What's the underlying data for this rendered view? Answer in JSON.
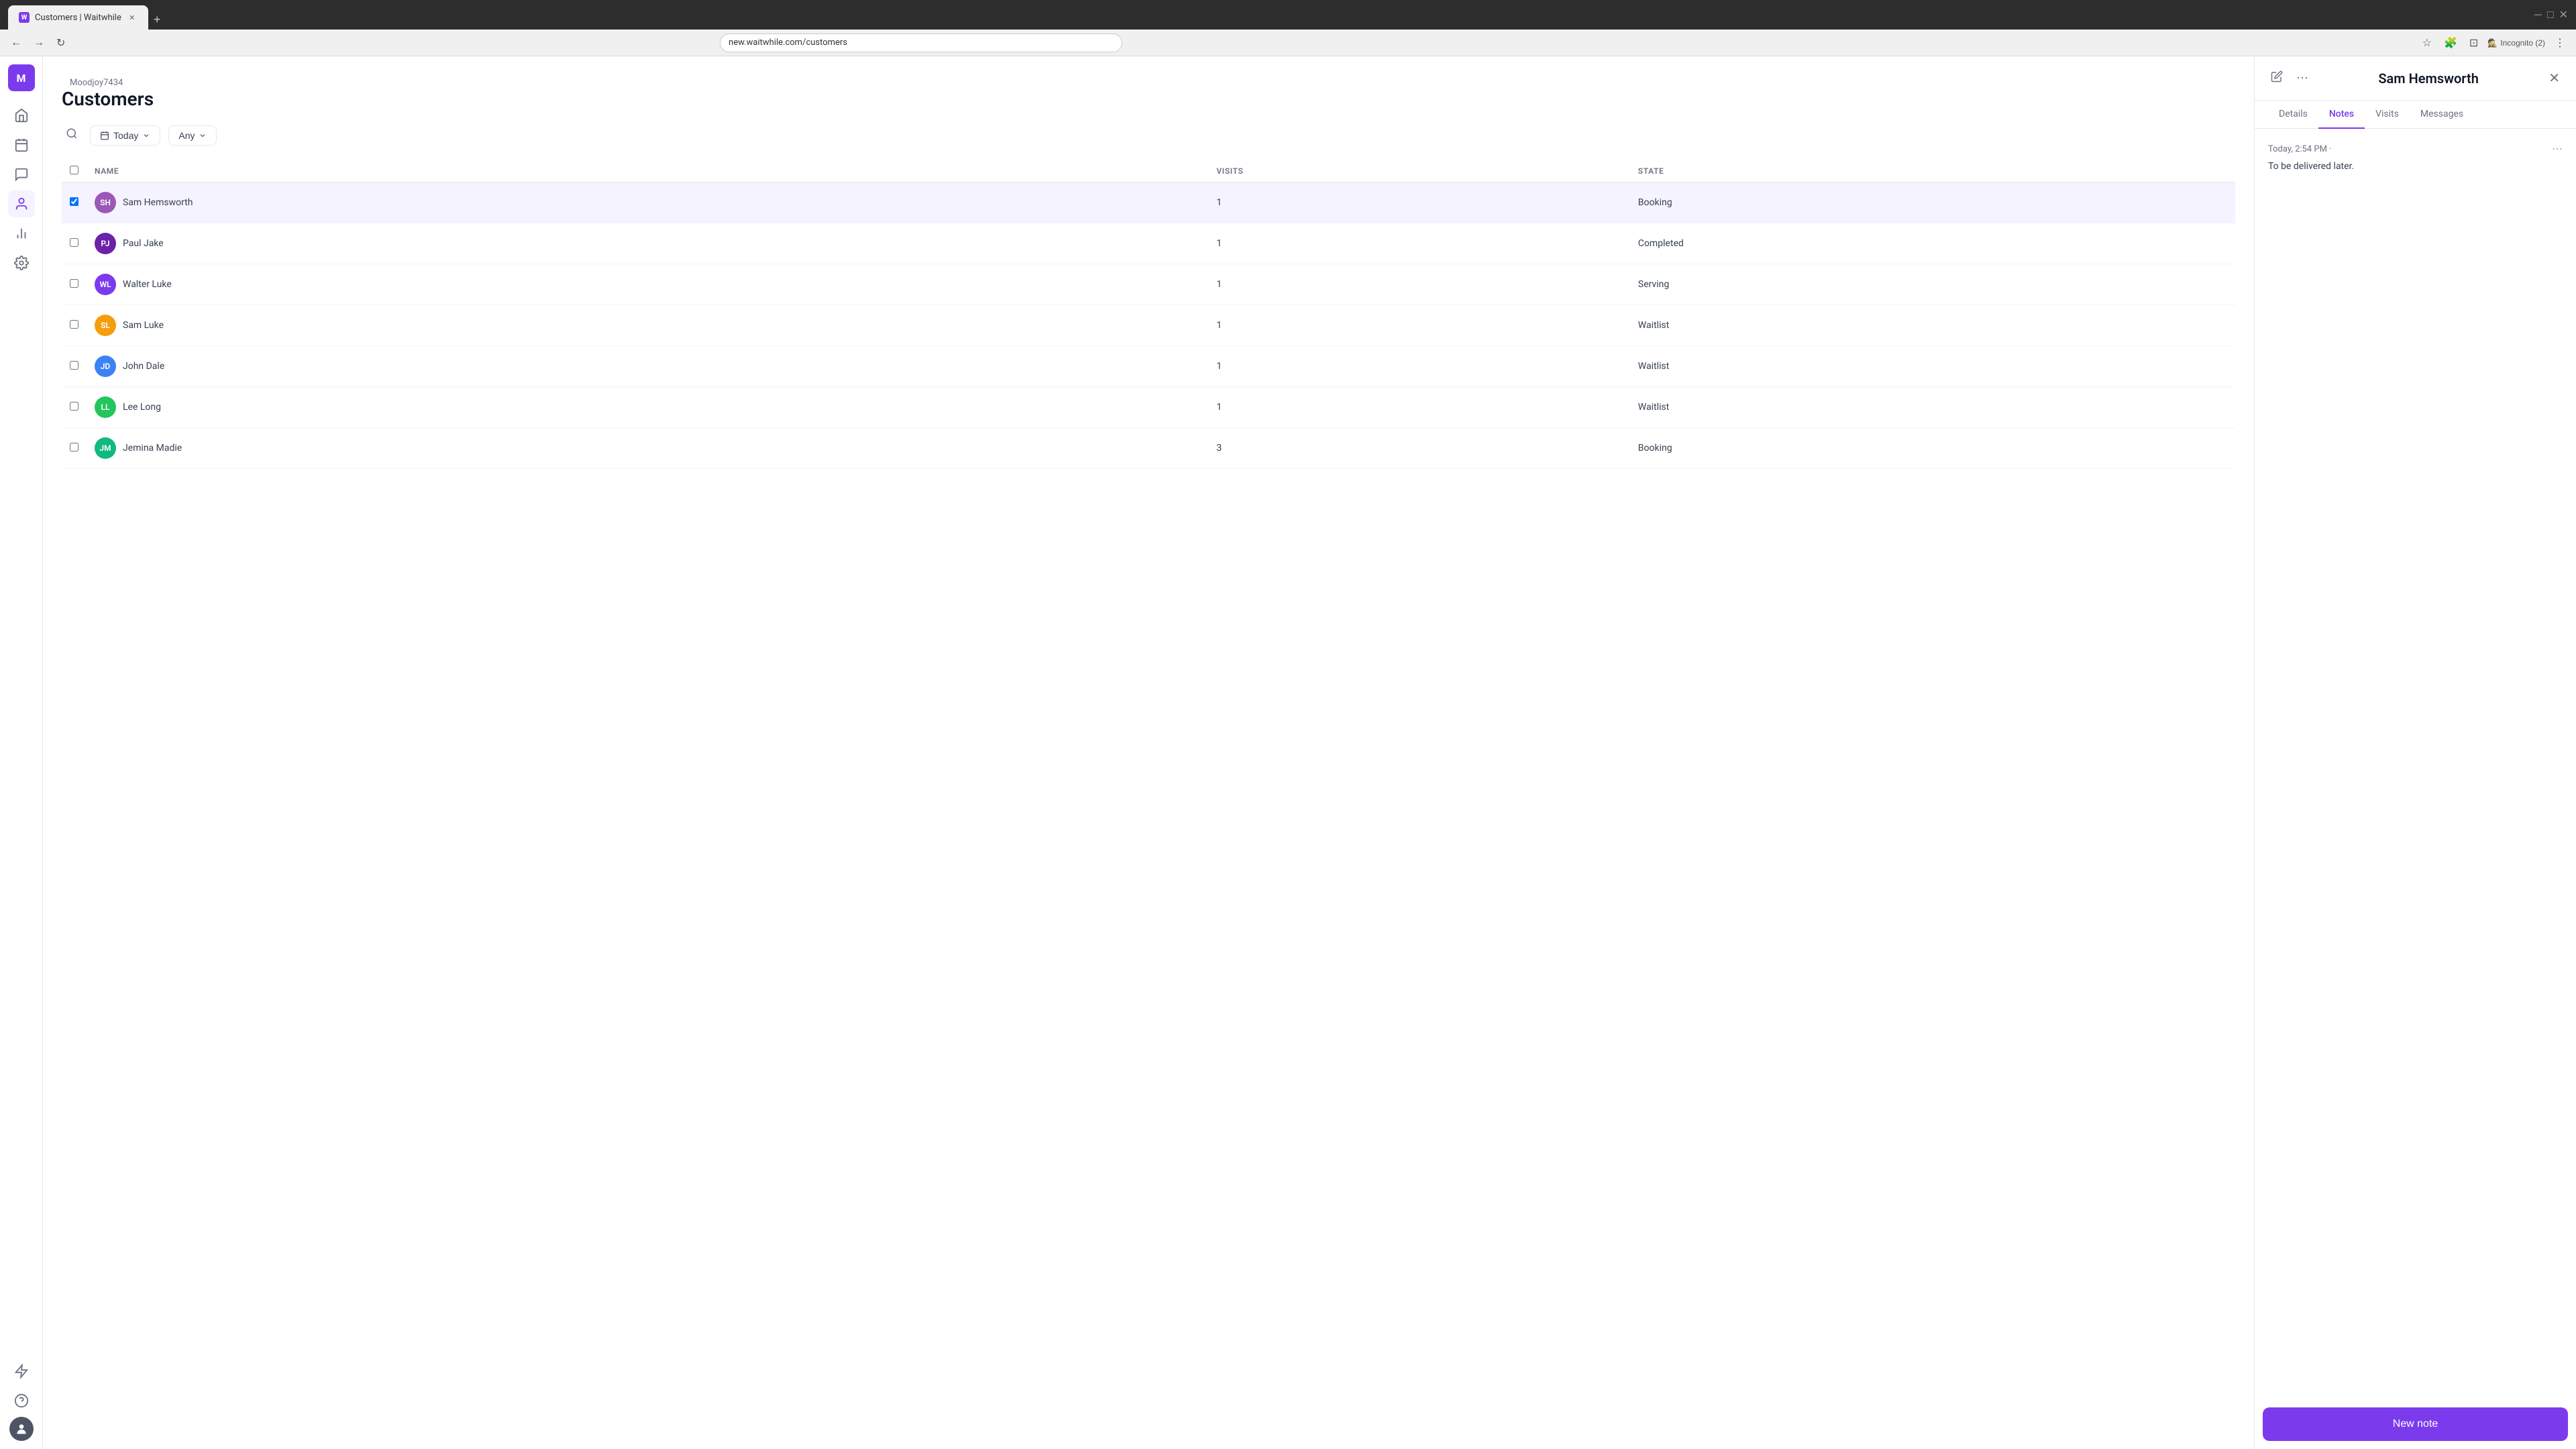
{
  "browser": {
    "tab_title": "Customers | Waitwhile",
    "tab_favicon": "W",
    "url": "new.waitwhile.com/customers",
    "incognito_label": "Incognito (2)"
  },
  "workspace": {
    "name": "Moodjoy7434",
    "avatar_letter": "M"
  },
  "page": {
    "title": "Customers"
  },
  "toolbar": {
    "filter1_label": "Today",
    "filter2_label": "Any"
  },
  "table": {
    "col_checkbox": "",
    "col_name": "NAME",
    "col_visits": "VISITS",
    "col_state": "STATE",
    "rows": [
      {
        "initials": "SH",
        "name": "Sam Hemsworth",
        "visits": "1",
        "state": "Booking",
        "color": "#9b59b6"
      },
      {
        "initials": "PJ",
        "name": "Paul Jake",
        "visits": "1",
        "state": "Completed",
        "color": "#6b21a8"
      },
      {
        "initials": "WL",
        "name": "Walter Luke",
        "visits": "1",
        "state": "Serving",
        "color": "#7c3aed"
      },
      {
        "initials": "SL",
        "name": "Sam Luke",
        "visits": "1",
        "state": "Waitlist",
        "color": "#f59e0b"
      },
      {
        "initials": "JD",
        "name": "John Dale",
        "visits": "1",
        "state": "Waitlist",
        "color": "#3b82f6"
      },
      {
        "initials": "LL",
        "name": "Lee Long",
        "visits": "1",
        "state": "Waitlist",
        "color": "#22c55e"
      },
      {
        "initials": "JM",
        "name": "Jemina Madie",
        "visits": "3",
        "state": "Booking",
        "color": "#10b981"
      }
    ]
  },
  "panel": {
    "customer_name": "Sam Hemsworth",
    "tabs": [
      {
        "id": "details",
        "label": "Details"
      },
      {
        "id": "notes",
        "label": "Notes"
      },
      {
        "id": "visits",
        "label": "Visits"
      },
      {
        "id": "messages",
        "label": "Messages"
      }
    ],
    "active_tab": "notes",
    "notes_title": "Notes",
    "note": {
      "timestamp": "Today, 2:54 PM",
      "timestamp_dot": "·",
      "text": "To be delivered later."
    },
    "new_note_label": "New note"
  },
  "sidebar": {
    "items": [
      {
        "id": "home",
        "icon": "⌂",
        "label": "Home"
      },
      {
        "id": "calendar",
        "icon": "▦",
        "label": "Calendar"
      },
      {
        "id": "chat",
        "icon": "💬",
        "label": "Messages"
      },
      {
        "id": "customers",
        "icon": "👤",
        "label": "Customers"
      },
      {
        "id": "analytics",
        "icon": "📊",
        "label": "Analytics"
      },
      {
        "id": "settings",
        "icon": "⚙",
        "label": "Settings"
      }
    ],
    "bottom_items": [
      {
        "id": "lightning",
        "icon": "⚡",
        "label": "Quick actions"
      },
      {
        "id": "help",
        "icon": "?",
        "label": "Help"
      }
    ],
    "user_avatar": "👤"
  }
}
